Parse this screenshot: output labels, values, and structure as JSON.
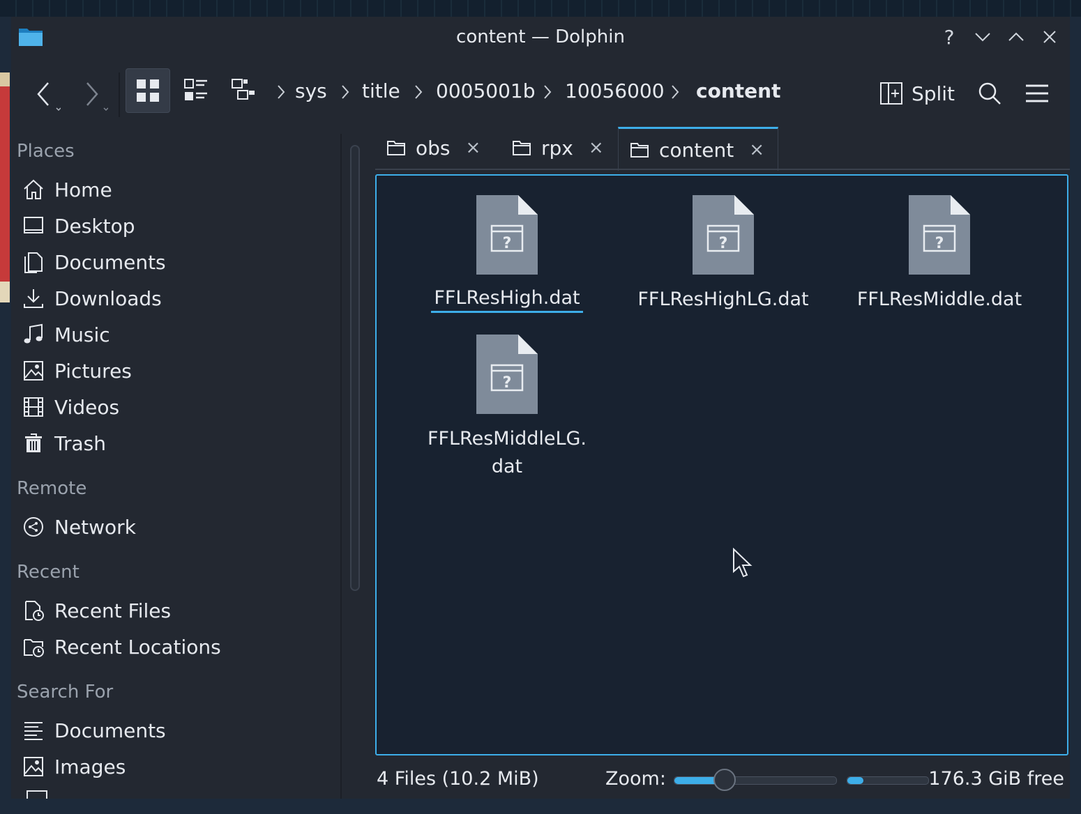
{
  "window": {
    "title": "content — Dolphin"
  },
  "toolbar": {
    "breadcrumbs": [
      "sys",
      "title",
      "0005001b",
      "10056000",
      "content"
    ],
    "split_label": "Split"
  },
  "sidebar": {
    "sections": [
      {
        "header": "Places",
        "items": [
          "Home",
          "Desktop",
          "Documents",
          "Downloads",
          "Music",
          "Pictures",
          "Videos",
          "Trash"
        ]
      },
      {
        "header": "Remote",
        "items": [
          "Network"
        ]
      },
      {
        "header": "Recent",
        "items": [
          "Recent Files",
          "Recent Locations"
        ]
      },
      {
        "header": "Search For",
        "items": [
          "Documents",
          "Images"
        ]
      }
    ]
  },
  "tabs": [
    {
      "label": "obs",
      "close": "×"
    },
    {
      "label": "rpx",
      "close": "×"
    },
    {
      "label": "content",
      "close": "×",
      "active": true
    }
  ],
  "files": [
    {
      "name": "FFLResHigh.dat",
      "selected": true
    },
    {
      "name": "FFLResHighLG.dat"
    },
    {
      "name": "FFLResMiddle.dat"
    },
    {
      "name_lines": [
        "FFLResMiddleLG.",
        "dat"
      ]
    }
  ],
  "status": {
    "summary": "4 Files (10.2 MiB)",
    "zoom_label": "Zoom:",
    "zoom_level": 0.28,
    "space_used_fraction": 0.2,
    "free_space": "176.3 GiB free"
  },
  "colors": {
    "accent": "#3daee9",
    "window_bg": "#232831",
    "view_bg": "#182230"
  }
}
